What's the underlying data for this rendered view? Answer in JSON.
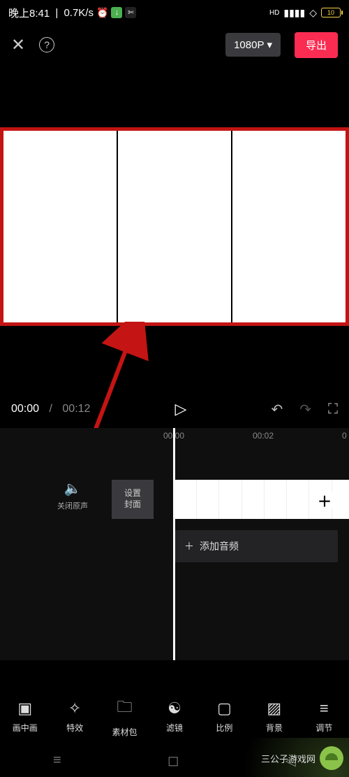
{
  "status": {
    "time": "晚上8:41",
    "net_speed": "0.7K/s",
    "battery": "10"
  },
  "topbar": {
    "resolution": "1080P",
    "export": "导出"
  },
  "playback": {
    "current": "00:00",
    "total": "00:12"
  },
  "ruler": {
    "t0": "00:00",
    "t1": "00:02",
    "t2": "0"
  },
  "timeline": {
    "mute_label": "关闭原声",
    "cover_label": "设置\n封面",
    "add_audio": "添加音频"
  },
  "tools": [
    {
      "icon": "pip-icon",
      "glyph": "▣",
      "label": "画中画"
    },
    {
      "icon": "effects-icon",
      "glyph": "✧",
      "label": "特效"
    },
    {
      "icon": "assets-icon",
      "glyph": "🗀",
      "label": "素材包"
    },
    {
      "icon": "filter-icon",
      "glyph": "☯",
      "label": "滤镜"
    },
    {
      "icon": "ratio-icon",
      "glyph": "▢",
      "label": "比例"
    },
    {
      "icon": "bg-icon",
      "glyph": "▨",
      "label": "背景"
    },
    {
      "icon": "adjust-icon",
      "glyph": "≡",
      "label": "调节"
    }
  ],
  "brand": {
    "text": "三公子游戏网"
  }
}
